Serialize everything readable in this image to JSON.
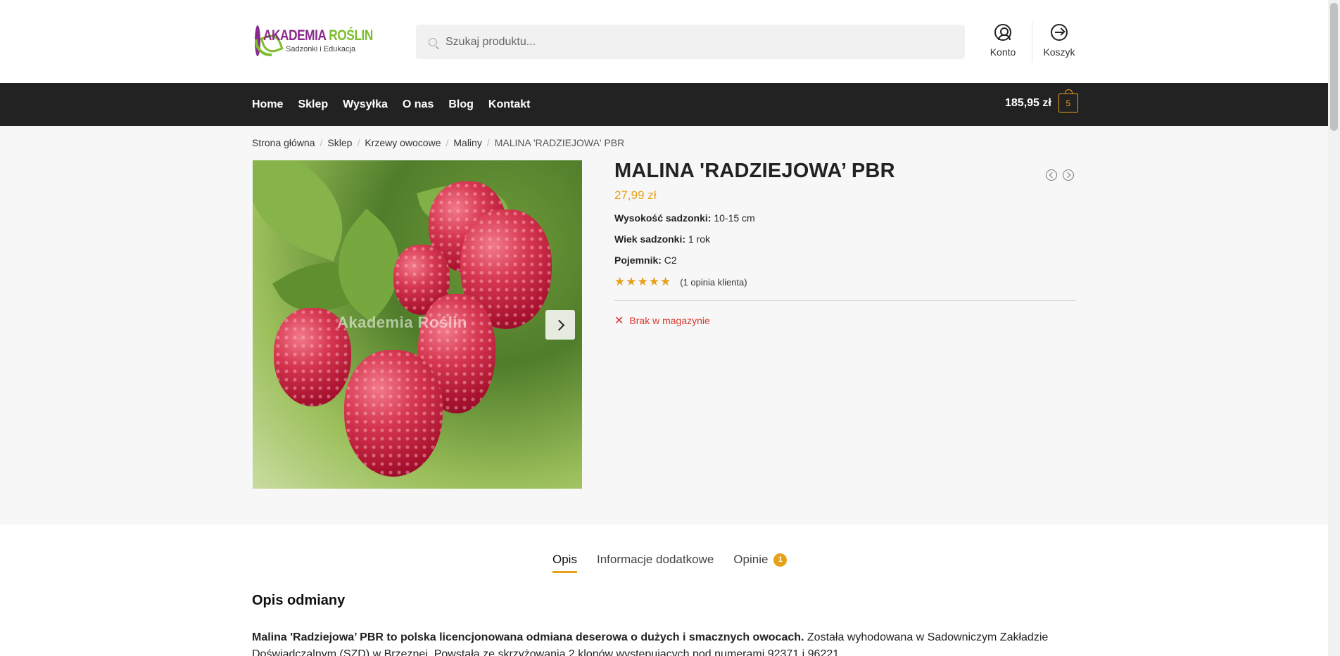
{
  "header": {
    "logo": {
      "title_part1": "AKADEMIA",
      "title_part2": "ROŚLIN",
      "subtitle": "Sadzonki i Edukacja"
    },
    "search": {
      "placeholder": "Szukaj produktu..."
    },
    "account_label": "Konto",
    "cart_label": "Koszyk"
  },
  "nav": {
    "items": [
      "Home",
      "Sklep",
      "Wysyłka",
      "O nas",
      "Blog",
      "Kontakt"
    ],
    "cart_total": "185,95 zł",
    "cart_count": "5"
  },
  "breadcrumb": [
    "Strona główna",
    "Sklep",
    "Krzewy owocowe",
    "Maliny",
    "MALINA 'RADZIEJOWA' PBR"
  ],
  "gallery": {
    "watermark": "Akademia Roślin"
  },
  "product": {
    "title": "MALINA 'RADZIEJOWA’ PBR",
    "price": "27,99 zł",
    "attributes": [
      {
        "label": "Wysokość sadzonki:",
        "value": "10-15 cm"
      },
      {
        "label": "Wiek sadzonki:",
        "value": "1 rok"
      },
      {
        "label": "Pojemnik:",
        "value": "C2"
      }
    ],
    "rating": {
      "stars": 5,
      "stars_glyphs": "★★★★★",
      "text": "(1 opinia klienta)"
    },
    "stock": {
      "icon": "✕",
      "text": "Brak w magazynie"
    }
  },
  "tabs": [
    {
      "label": "Opis",
      "active": true
    },
    {
      "label": "Informacje dodatkowe",
      "active": false
    },
    {
      "label": "Opinie",
      "active": false,
      "badge": "1"
    }
  ],
  "description": {
    "heading": "Opis odmiany",
    "bold_lead": "Malina 'Radziejowa’ PBR to polska licencjonowana odmiana deserowa o dużych i smacznych owocach.",
    "text": " Została wyhodowana w Sadowniczym Zakładzie Doświadczalnym (SZD) w Brzeznej. Powstała ze skrzyżowania 2 klonów występujących pod numerami 92371 i 96221."
  },
  "colors": {
    "accent": "#e6a019",
    "nav_bg": "#222222",
    "stock_red": "#d9372b",
    "brand_purple": "#8a2a8c",
    "brand_green": "#7bbd2c"
  }
}
